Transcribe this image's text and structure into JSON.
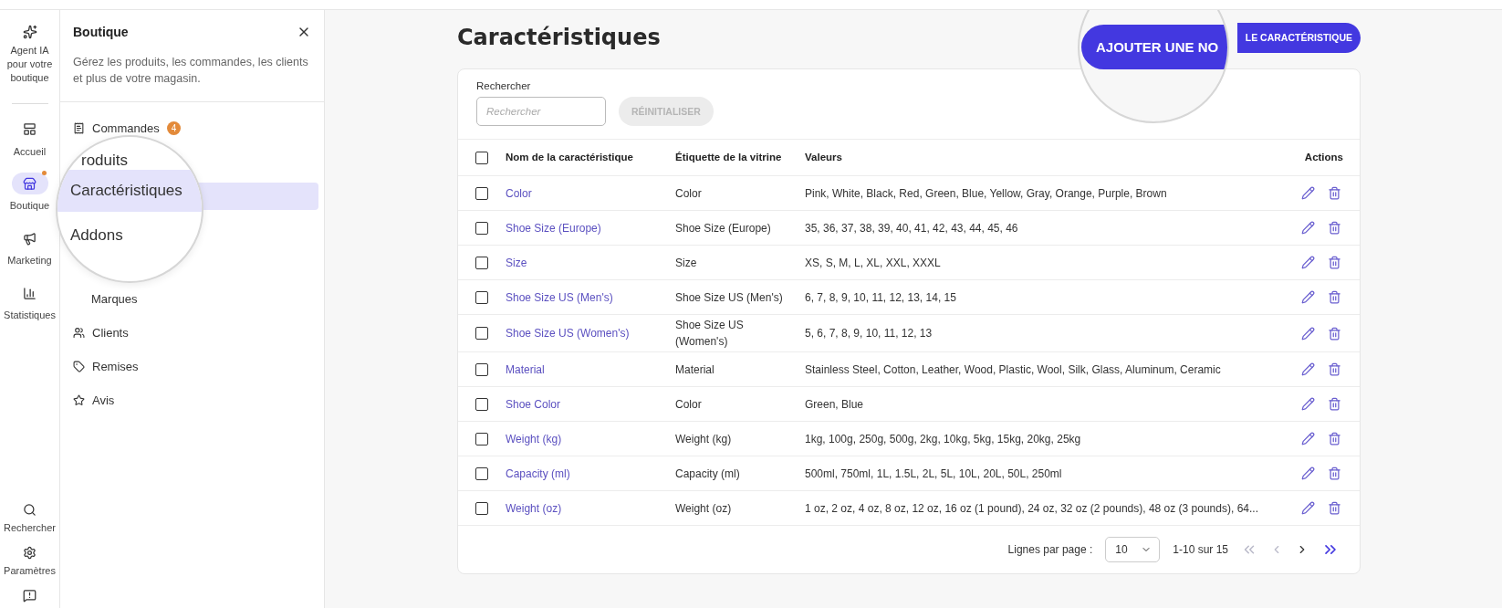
{
  "rail": {
    "agent": {
      "label": "Agent IA pour votre boutique"
    },
    "items": [
      {
        "kind": "home",
        "label": "Accueil",
        "selected": false,
        "notification": false
      },
      {
        "kind": "shop",
        "label": "Boutique",
        "selected": true,
        "notification": true
      },
      {
        "kind": "marketing",
        "label": "Marketing",
        "selected": false,
        "notification": false
      },
      {
        "kind": "stats",
        "label": "Statistiques",
        "selected": false,
        "notification": false
      }
    ],
    "bottom": [
      {
        "kind": "search",
        "label": "Rechercher"
      },
      {
        "kind": "settings",
        "label": "Paramètres"
      },
      {
        "kind": "feedback"
      }
    ]
  },
  "panel": {
    "title": "Boutique",
    "description": "Gérez les produits, les commandes, les clients et plus de votre magasin.",
    "items": [
      {
        "kind": "orders",
        "label": "Commandes",
        "badge": "4"
      },
      {
        "kind": "magnified"
      },
      {
        "kind": "sub",
        "label": "Marques"
      },
      {
        "kind": "clients",
        "label": "Clients"
      },
      {
        "kind": "discounts",
        "label": "Remises"
      },
      {
        "kind": "reviews",
        "label": "Avis"
      }
    ],
    "magnifier": [
      {
        "label": "roduits",
        "selected": false
      },
      {
        "label": "Caractéristiques",
        "selected": true
      },
      {
        "label": "Addons",
        "selected": false
      }
    ]
  },
  "page": {
    "title": "Caractéristiques",
    "add_button": {
      "label": "LE CARACTÉRISTIQUE",
      "magnified_label": "AJOUTER UNE NO"
    }
  },
  "filter": {
    "label": "Rechercher",
    "placeholder": "Rechercher",
    "reset": "RÉINITIALISER",
    "reset_disabled": true
  },
  "table": {
    "all_checked": false,
    "columns": [
      "Nom de la caractéristique",
      "Étiquette de la vitrine",
      "Valeurs",
      "Actions"
    ],
    "rows": [
      {
        "name": "Color",
        "label": "Color",
        "values": "Pink, White, Black, Red, Green, Blue, Yellow, Gray, Orange, Purple, Brown",
        "checked": false
      },
      {
        "name": "Shoe Size (Europe)",
        "label": "Shoe Size (Europe)",
        "values": "35, 36, 37, 38, 39, 40, 41, 42, 43, 44, 45, 46",
        "checked": false
      },
      {
        "name": "Size",
        "label": "Size",
        "values": "XS, S, M, L, XL, XXL, XXXL",
        "checked": false
      },
      {
        "name": "Shoe Size US (Men's)",
        "label": "Shoe Size US (Men's)",
        "values": "6, 7, 8, 9, 10, 11, 12, 13, 14, 15",
        "checked": false
      },
      {
        "name": "Shoe Size US (Women's)",
        "label": "Shoe Size US (Women's)",
        "values": "5, 6, 7, 8, 9, 10, 11, 12, 13",
        "checked": false
      },
      {
        "name": "Material",
        "label": "Material",
        "values": "Stainless Steel, Cotton, Leather, Wood, Plastic, Wool, Silk, Glass, Aluminum, Ceramic",
        "checked": false
      },
      {
        "name": "Shoe Color",
        "label": "Color",
        "values": "Green, Blue",
        "checked": false
      },
      {
        "name": "Weight (kg)",
        "label": "Weight (kg)",
        "values": "1kg, 100g, 250g, 500g, 2kg, 10kg, 5kg, 15kg, 20kg, 25kg",
        "checked": false
      },
      {
        "name": "Capacity (ml)",
        "label": "Capacity (ml)",
        "values": "500ml, 750ml, 1L, 1.5L, 2L, 5L, 10L, 20L, 50L, 250ml",
        "checked": false
      },
      {
        "name": "Weight (oz)",
        "label": "Weight (oz)",
        "values": "1 oz, 2 oz, 4 oz, 8 oz, 12 oz, 16 oz (1 pound), 24 oz, 32 oz (2 pounds), 48 oz (3 pounds), 64...",
        "checked": false
      }
    ]
  },
  "pagination": {
    "rows_label": "Lignes par page :",
    "rows_value": "10",
    "range": "1-10 sur 15",
    "first_disabled": true,
    "prev_disabled": true,
    "next_disabled": false,
    "last_disabled": false
  }
}
